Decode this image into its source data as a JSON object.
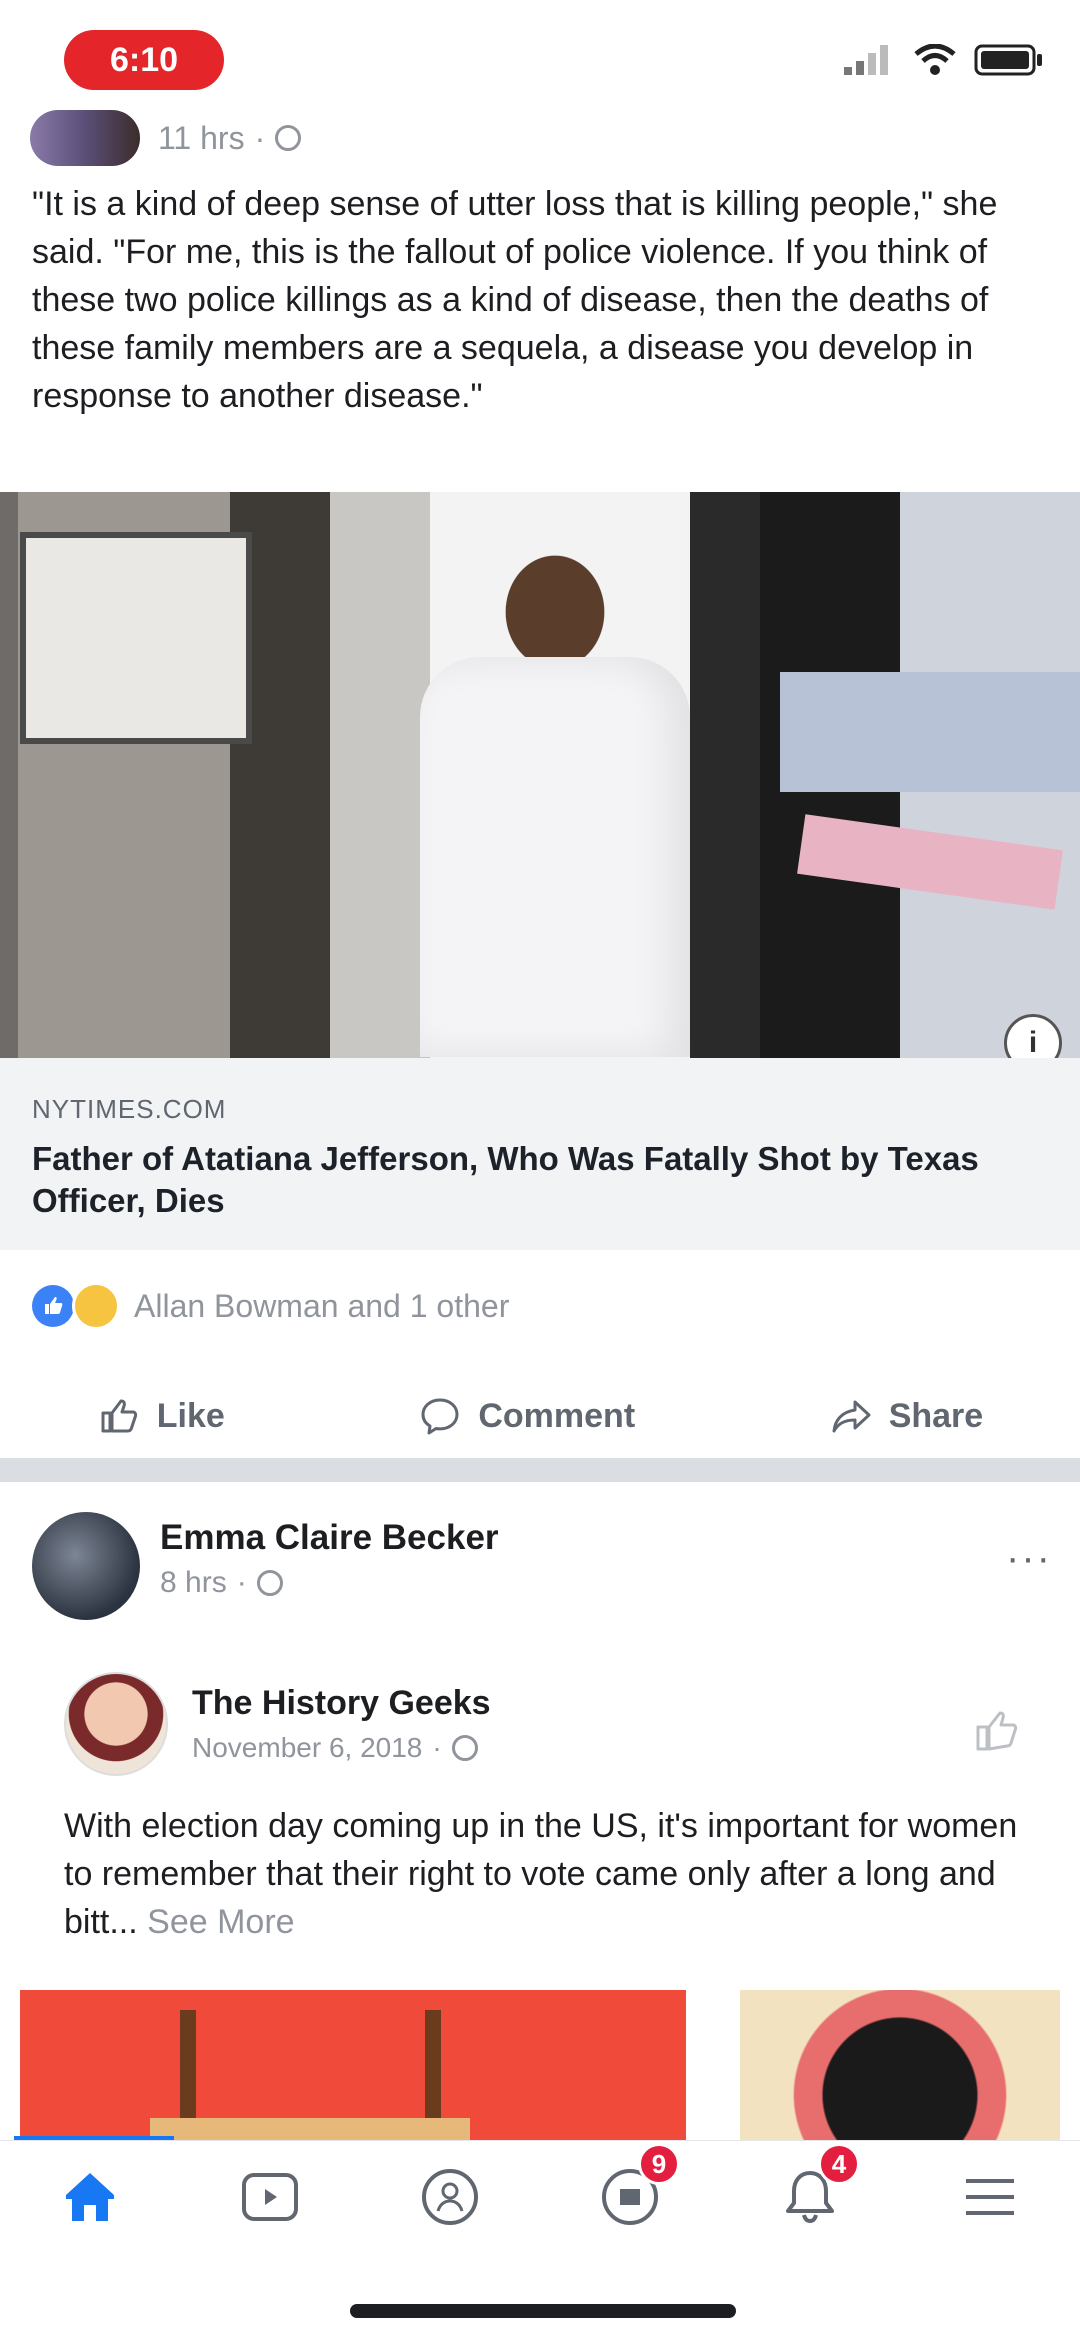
{
  "status_bar": {
    "time": "6:10"
  },
  "post1": {
    "header_meta": "11 hrs",
    "text": "\"It is a kind of deep sense of utter loss that is killing people,\" she said. \"For me, this is the fallout of police violence. If you think of these two police killings as a kind of disease, then the deaths of these family members are a sequela, a disease you develop in response to another disease.\"",
    "link": {
      "domain": "NYTIMES.COM",
      "title": "Father of Atatiana Jefferson, Who Was Fatally Shot by Texas Officer, Dies",
      "info_glyph": "i"
    },
    "reactions_text": "Allan Bowman and 1 other",
    "actions": {
      "like": "Like",
      "comment": "Comment",
      "share": "Share"
    }
  },
  "post2": {
    "author": "Emma Claire Becker",
    "time": "8 hrs",
    "more": "···",
    "shared": {
      "name": "The History Geeks",
      "date": "November 6, 2018",
      "text": "With election day coming up in the US, it's important for women to remember that their right to vote came only after a long and bitt... ",
      "see_more": "See More"
    }
  },
  "nav": {
    "items": [
      {
        "icon": "home-icon",
        "active": true
      },
      {
        "icon": "watch-icon"
      },
      {
        "icon": "groups-icon"
      },
      {
        "icon": "marketplace-icon",
        "badge": "9"
      },
      {
        "icon": "notifications-icon",
        "badge": "4"
      },
      {
        "icon": "menu-icon"
      }
    ]
  },
  "colors": {
    "accent": "#1877f2",
    "badge": "#e41e3f",
    "time_pill": "#e4262b"
  }
}
